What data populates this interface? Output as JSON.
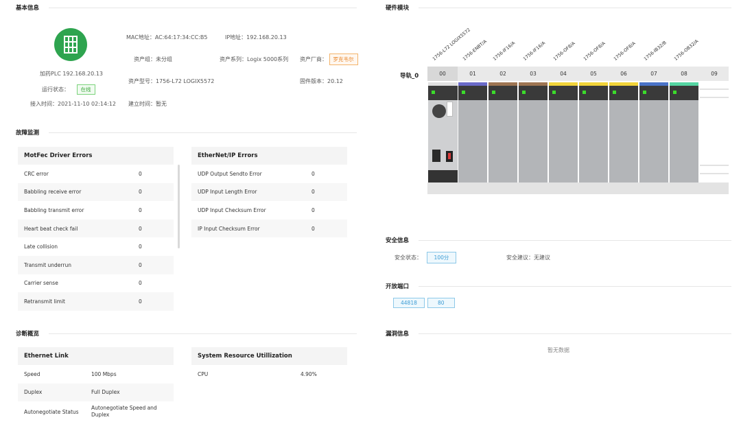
{
  "sections": {
    "basic": "基本信息",
    "hardware": "硬件模块",
    "fault": "故障监测",
    "diag": "诊断概览",
    "security": "安全信息",
    "ports": "开放端口",
    "vuln": "漏洞信息"
  },
  "basic": {
    "device_name": "加药PLC 192.168.20.13",
    "run_status_label": "运行状态：",
    "run_status": "在线",
    "access_time": "接入时间：2021-11-10 02:14:12",
    "mac": "MAC地址：AC:64:17:34:CC:B5",
    "ip": "IP地址：192.168.20.13",
    "asset_group": "资产组：未分组",
    "asset_series": "资产系列：Logix 5000系列",
    "asset_vendor_label": "资产厂商：",
    "asset_vendor": "罗克韦尔",
    "asset_model": "资产型号：1756-L72 LOGIX5572",
    "firmware": "固件版本：20.12",
    "created": "建立时间：暂无"
  },
  "hardware": {
    "rail_label": "导轨_0",
    "module_labels": [
      "1756-L72 LOGIX5572",
      "1756-ENBT/A",
      "1756-IF16/A",
      "1756-IF16/A",
      "1756-OF8/A",
      "1756-OF8/A",
      "1756-OF8/A",
      "1756-IB32/B",
      "1756-OB32/A"
    ],
    "slots": [
      "00",
      "01",
      "02",
      "03",
      "04",
      "05",
      "06",
      "07",
      "08",
      "09"
    ],
    "strip_colors": [
      "#6a6ac9",
      "#9e7552",
      "#9e7552",
      "#f2d43a",
      "#f2d43a",
      "#f2d43a",
      "#4a73c8",
      "#55d6a3"
    ]
  },
  "fault": {
    "motfec": {
      "title": "MotFec Driver Errors",
      "rows": [
        {
          "name": "CRC error",
          "value": "0"
        },
        {
          "name": "Babbling receive error",
          "value": "0"
        },
        {
          "name": "Babbling transmit error",
          "value": "0"
        },
        {
          "name": "Heart beat check fail",
          "value": "0"
        },
        {
          "name": "Late collision",
          "value": "0"
        },
        {
          "name": "Transmit underrun",
          "value": "0"
        },
        {
          "name": "Carrier sense",
          "value": "0"
        },
        {
          "name": "Retransmit limit",
          "value": "0"
        }
      ]
    },
    "ethernetip": {
      "title": "EtherNet/IP Errors",
      "rows": [
        {
          "name": "UDP Output Sendto Error",
          "value": "0"
        },
        {
          "name": "UDP Input Length Error",
          "value": "0"
        },
        {
          "name": "UDP Input Checksum Error",
          "value": "0"
        },
        {
          "name": "IP Input Checksum Error",
          "value": "0"
        }
      ]
    }
  },
  "diag": {
    "ethernet": {
      "title": "Ethernet Link",
      "rows": [
        {
          "name": "Speed",
          "value": "100 Mbps"
        },
        {
          "name": "Duplex",
          "value": "Full Duplex"
        },
        {
          "name": "Autonegotiate Status",
          "value": "Autonegotiate Speed and Duplex"
        }
      ]
    },
    "resource": {
      "title": "System Resource Utillization",
      "rows": [
        {
          "name": "CPU",
          "value": "4.90%"
        }
      ]
    }
  },
  "security": {
    "status_label": "安全状态：",
    "status_value": "100分",
    "advice": "安全建议：无建议"
  },
  "ports": [
    "44818",
    "80"
  ],
  "vuln": {
    "empty": "暂无数据"
  },
  "colors": {
    "online": "#3aa83a",
    "vendor": "#e8872b",
    "port": "#3b9bd4",
    "logo": "#2ea44f"
  }
}
